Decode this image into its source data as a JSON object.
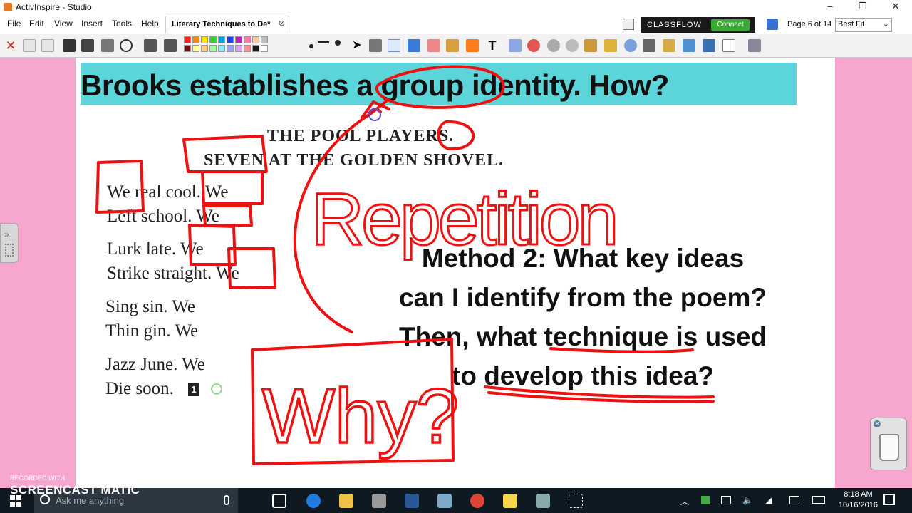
{
  "window": {
    "title": "ActivInspire - Studio",
    "minimize": "–",
    "restore": "❐",
    "close": "✕"
  },
  "menu": [
    "File",
    "Edit",
    "View",
    "Insert",
    "Tools",
    "Help"
  ],
  "document_tab": {
    "label": "Literary Techniques to De*",
    "close": "⊗"
  },
  "classflow": {
    "label": "CLASSFLOW",
    "connect": "Connect"
  },
  "page_indicator": "Page 6 of 14",
  "zoom": "Best Fit",
  "palette": [
    "#ff2020",
    "#ff8a00",
    "#ffe300",
    "#2ed12e",
    "#00a0e0",
    "#1c3cff",
    "#c020c0",
    "#ff7aa8",
    "#ffc8a0",
    "#c0c0c0",
    "#6a1010",
    "#fdfd90",
    "#ffcf80",
    "#a0ffa0",
    "#8fe8ff",
    "#a0a0ff",
    "#e0a0ff",
    "#ff9090",
    "#1a1a1a",
    "#ffffff"
  ],
  "slide": {
    "banner_text": "Brooks establishes a group identity.  How?",
    "poem_title_1": "THE POOL PLAYERS.",
    "poem_title_2": "SEVEN AT THE GOLDEN SHOVEL.",
    "poem_lines": [
      "We real cool. We",
      "Left school. We",
      "Lurk late. We",
      "Strike straight. We",
      "Sing sin. We",
      "Thin gin. We",
      "Jazz June. We",
      "Die soon."
    ],
    "line_marker": "1",
    "method_lines": [
      "Method 2: What key ideas",
      "can I identify from the poem?",
      "Then, what technique is used",
      "to develop this idea?"
    ],
    "annotations": [
      "Repetition",
      "Why?"
    ]
  },
  "taskbar": {
    "search_placeholder": "Ask me anything",
    "time": "8:18 AM",
    "date": "10/16/2016"
  },
  "watermark": {
    "recorded": "RECORDED WITH",
    "brand": "SCREENCAST  MATIC"
  }
}
